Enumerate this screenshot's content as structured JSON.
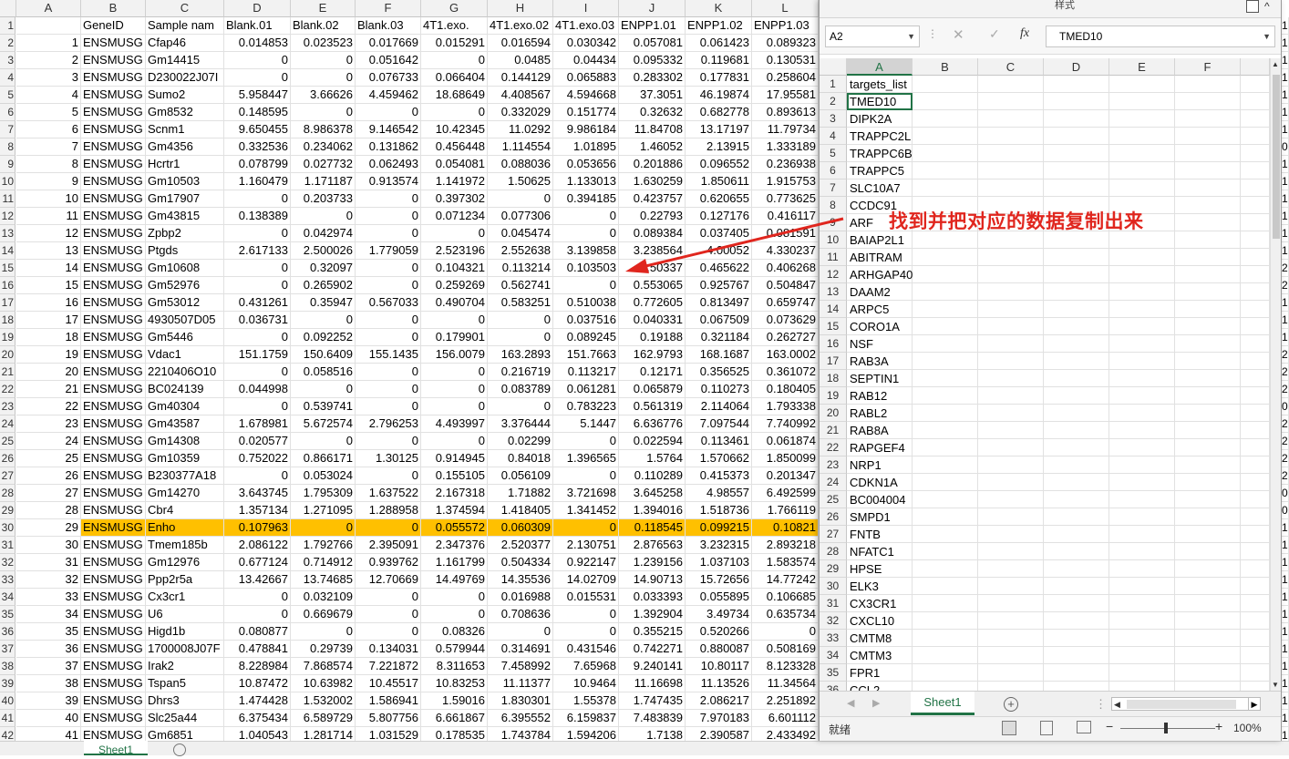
{
  "main_sheet": {
    "columns": [
      "A",
      "B",
      "C",
      "D",
      "E",
      "F",
      "G",
      "H",
      "I",
      "J",
      "K",
      "L"
    ],
    "header_row": [
      "",
      "GeneID",
      "Sample nam",
      "Blank.01",
      "Blank.02",
      "Blank.03",
      "4T1.exo.",
      "4T1.exo.02",
      "4T1.exo.03",
      "ENPP1.01",
      "ENPP1.02",
      "ENPP1.03"
    ],
    "rows": [
      [
        "1",
        "ENSMUSG",
        "Cfap46",
        "0.014853",
        "0.023523",
        "0.017669",
        "0.015291",
        "0.016594",
        "0.030342",
        "0.057081",
        "0.061423",
        "0.089323"
      ],
      [
        "2",
        "ENSMUSG",
        "Gm14415",
        "0",
        "0",
        "0.051642",
        "0",
        "0.0485",
        "0.04434",
        "0.095332",
        "0.119681",
        "0.130531"
      ],
      [
        "3",
        "ENSMUSG",
        "D230022J07I",
        "0",
        "0",
        "0.076733",
        "0.066404",
        "0.144129",
        "0.065883",
        "0.283302",
        "0.177831",
        "0.258604"
      ],
      [
        "4",
        "ENSMUSG",
        "Sumo2",
        "5.958447",
        "3.66626",
        "4.459462",
        "18.68649",
        "4.408567",
        "4.594668",
        "37.3051",
        "46.19874",
        "17.95581"
      ],
      [
        "5",
        "ENSMUSG",
        "Gm8532",
        "0.148595",
        "0",
        "0",
        "0",
        "0.332029",
        "0.151774",
        "0.32632",
        "0.682778",
        "0.893613"
      ],
      [
        "6",
        "ENSMUSG",
        "Scnm1",
        "9.650455",
        "8.986378",
        "9.146542",
        "10.42345",
        "11.0292",
        "9.986184",
        "11.84708",
        "13.17197",
        "11.79734"
      ],
      [
        "7",
        "ENSMUSG",
        "Gm4356",
        "0.332536",
        "0.234062",
        "0.131862",
        "0.456448",
        "1.114554",
        "1.01895",
        "1.46052",
        "2.13915",
        "1.333189"
      ],
      [
        "8",
        "ENSMUSG",
        "Hcrtr1",
        "0.078799",
        "0.027732",
        "0.062493",
        "0.054081",
        "0.088036",
        "0.053656",
        "0.201886",
        "0.096552",
        "0.236938"
      ],
      [
        "9",
        "ENSMUSG",
        "Gm10503",
        "1.160479",
        "1.171187",
        "0.913574",
        "1.141972",
        "1.50625",
        "1.133013",
        "1.630259",
        "1.850611",
        "1.915753"
      ],
      [
        "10",
        "ENSMUSG",
        "Gm17907",
        "0",
        "0.203733",
        "0",
        "0.397302",
        "0",
        "0.394185",
        "0.423757",
        "0.620655",
        "0.773625"
      ],
      [
        "11",
        "ENSMUSG",
        "Gm43815",
        "0.138389",
        "0",
        "0",
        "0.071234",
        "0.077306",
        "0",
        "0.22793",
        "0.127176",
        "0.416117"
      ],
      [
        "12",
        "ENSMUSG",
        "Zpbp2",
        "0",
        "0.042974",
        "0",
        "0",
        "0.045474",
        "0",
        "0.089384",
        "0.037405",
        "0.081591"
      ],
      [
        "13",
        "ENSMUSG",
        "Ptgds",
        "2.617133",
        "2.500026",
        "1.779059",
        "2.523196",
        "2.552638",
        "3.139858",
        "3.238564",
        "4.00052",
        "4.330237"
      ],
      [
        "14",
        "ENSMUSG",
        "Gm10608",
        "0",
        "0.32097",
        "0",
        "0.104321",
        "0.113214",
        "0.103503",
        "0.50337",
        "0.465622",
        "0.406268"
      ],
      [
        "15",
        "ENSMUSG",
        "Gm52976",
        "0",
        "0.265902",
        "0",
        "0.259269",
        "0.562741",
        "0",
        "0.553065",
        "0.925767",
        "0.504847"
      ],
      [
        "16",
        "ENSMUSG",
        "Gm53012",
        "0.431261",
        "0.35947",
        "0.567033",
        "0.490704",
        "0.583251",
        "0.510038",
        "0.772605",
        "0.813497",
        "0.659747"
      ],
      [
        "17",
        "ENSMUSG",
        "4930507D05",
        "0.036731",
        "0",
        "0",
        "0",
        "0",
        "0.037516",
        "0.040331",
        "0.067509",
        "0.073629"
      ],
      [
        "18",
        "ENSMUSG",
        "Gm5446",
        "0",
        "0.092252",
        "0",
        "0.179901",
        "0",
        "0.089245",
        "0.19188",
        "0.321184",
        "0.262727"
      ],
      [
        "19",
        "ENSMUSG",
        "Vdac1",
        "151.1759",
        "150.6409",
        "155.1435",
        "156.0079",
        "163.2893",
        "151.7663",
        "162.9793",
        "168.1687",
        "163.0002"
      ],
      [
        "20",
        "ENSMUSG",
        "2210406O10",
        "0",
        "0.058516",
        "0",
        "0",
        "0.216719",
        "0.113217",
        "0.12171",
        "0.356525",
        "0.361072"
      ],
      [
        "21",
        "ENSMUSG",
        "BC024139",
        "0.044998",
        "0",
        "0",
        "0",
        "0.083789",
        "0.061281",
        "0.065879",
        "0.110273",
        "0.180405"
      ],
      [
        "22",
        "ENSMUSG",
        "Gm40304",
        "0",
        "0.539741",
        "0",
        "0",
        "0",
        "0.783223",
        "0.561319",
        "2.114064",
        "1.793338"
      ],
      [
        "23",
        "ENSMUSG",
        "Gm43587",
        "1.678981",
        "5.672574",
        "2.796253",
        "4.493997",
        "3.376444",
        "5.1447",
        "6.636776",
        "7.097544",
        "7.740992"
      ],
      [
        "24",
        "ENSMUSG",
        "Gm14308",
        "0.020577",
        "0",
        "0",
        "0",
        "0.02299",
        "0",
        "0.022594",
        "0.113461",
        "0.061874"
      ],
      [
        "25",
        "ENSMUSG",
        "Gm10359",
        "0.752022",
        "0.866171",
        "1.30125",
        "0.914945",
        "0.84018",
        "1.396565",
        "1.5764",
        "1.570662",
        "1.850099"
      ],
      [
        "26",
        "ENSMUSG",
        "B230377A18",
        "0",
        "0.053024",
        "0",
        "0.155105",
        "0.056109",
        "0",
        "0.110289",
        "0.415373",
        "0.201347"
      ],
      [
        "27",
        "ENSMUSG",
        "Gm14270",
        "3.643745",
        "1.795309",
        "1.637522",
        "2.167318",
        "1.71882",
        "3.721698",
        "3.645258",
        "4.98557",
        "6.492599"
      ],
      [
        "28",
        "ENSMUSG",
        "Cbr4",
        "1.357134",
        "1.271095",
        "1.288958",
        "1.374594",
        "1.418405",
        "1.341452",
        "1.394016",
        "1.518736",
        "1.766119"
      ],
      [
        "29",
        "ENSMUSG",
        "Enho",
        "0.107963",
        "0",
        "0",
        "0.055572",
        "0.060309",
        "0",
        "0.118545",
        "0.099215",
        "0.10821"
      ],
      [
        "30",
        "ENSMUSG",
        "Tmem185b",
        "2.086122",
        "1.792766",
        "2.395091",
        "2.347376",
        "2.520377",
        "2.130751",
        "2.876563",
        "3.232315",
        "2.893218"
      ],
      [
        "31",
        "ENSMUSG",
        "Gm12976",
        "0.677124",
        "0.714912",
        "0.939762",
        "1.161799",
        "0.504334",
        "0.922147",
        "1.239156",
        "1.037103",
        "1.583574"
      ],
      [
        "32",
        "ENSMUSG",
        "Ppp2r5a",
        "13.42667",
        "13.74685",
        "12.70669",
        "14.49769",
        "14.35536",
        "14.02709",
        "14.90713",
        "15.72656",
        "14.77242"
      ],
      [
        "33",
        "ENSMUSG",
        "Cx3cr1",
        "0",
        "0.032109",
        "0",
        "0",
        "0.016988",
        "0.015531",
        "0.033393",
        "0.055895",
        "0.106685"
      ],
      [
        "34",
        "ENSMUSG",
        "U6",
        "0",
        "0.669679",
        "0",
        "0",
        "0.708636",
        "0",
        "1.392904",
        "3.49734",
        "0.635734"
      ],
      [
        "35",
        "ENSMUSG",
        "Higd1b",
        "0.080877",
        "0",
        "0",
        "0.08326",
        "0",
        "0",
        "0.355215",
        "0.520266",
        "0"
      ],
      [
        "36",
        "ENSMUSG",
        "1700008J07F",
        "0.478841",
        "0.29739",
        "0.134031",
        "0.579944",
        "0.314691",
        "0.431546",
        "0.742271",
        "0.880087",
        "0.508169"
      ],
      [
        "37",
        "ENSMUSG",
        "Irak2",
        "8.228984",
        "7.868574",
        "7.221872",
        "8.311653",
        "7.458992",
        "7.65968",
        "9.240141",
        "10.80117",
        "8.123328"
      ],
      [
        "38",
        "ENSMUSG",
        "Tspan5",
        "10.87472",
        "10.63982",
        "10.45517",
        "10.83253",
        "11.11377",
        "10.9464",
        "11.16698",
        "11.13526",
        "11.34564"
      ],
      [
        "39",
        "ENSMUSG",
        "Dhrs3",
        "1.474428",
        "1.532002",
        "1.586941",
        "1.59016",
        "1.830301",
        "1.55378",
        "1.747435",
        "2.086217",
        "2.251892"
      ],
      [
        "40",
        "ENSMUSG",
        "Slc25a44",
        "6.375434",
        "6.589729",
        "5.807756",
        "6.661867",
        "6.395552",
        "6.159837",
        "7.483839",
        "7.970183",
        "6.601112"
      ],
      [
        "41",
        "ENSMUSG",
        "Gm6851",
        "1.040543",
        "1.281714",
        "1.031529",
        "0.178535",
        "1.743784",
        "1.594206",
        "1.7138",
        "2.390587",
        "2.433492"
      ]
    ],
    "highlight_row_label": "30",
    "highlight_color": "#ffc000",
    "right_edge_digits": [
      "1",
      "1",
      "1",
      "1",
      "1",
      "1",
      "1",
      "0",
      "1",
      "1",
      "1",
      "1",
      "1",
      "1",
      "2",
      "2",
      "1",
      "1",
      "1",
      "2",
      "2",
      "2",
      "0",
      "2",
      "2",
      "2",
      "2",
      "0",
      "0",
      "1",
      "1",
      "1",
      "1",
      "1",
      "1",
      "1",
      "1",
      "1",
      "1",
      "1",
      "1",
      "1"
    ],
    "tab_label": "Sheet1"
  },
  "second_window": {
    "ribbon_label": "样式",
    "name_box": "A2",
    "formula_value": "TMED10",
    "columns": [
      "A",
      "B",
      "C",
      "D",
      "E",
      "F"
    ],
    "cells": [
      "targets_list",
      "TMED10",
      "DIPK2A",
      "TRAPPC2L",
      "TRAPPC6B",
      "TRAPPC5",
      "SLC10A7",
      "CCDC91",
      "ARF",
      "BAIAP2L1",
      "ABITRAM",
      "ARHGAP40",
      "DAAM2",
      "ARPC5",
      "CORO1A",
      "NSF",
      "RAB3A",
      "SEPTIN1",
      "RAB12",
      "RABL2",
      "RAB8A",
      "RAPGEF4",
      "NRP1",
      "CDKN1A",
      "BC004004",
      "SMPD1",
      "FNTB",
      "NFATC1",
      "HPSE",
      "ELK3",
      "CX3CR1",
      "CXCL10",
      "CMTM8",
      "CMTM3",
      "FPR1",
      "CCL2"
    ],
    "sheet_tab": "Sheet1",
    "status_text": "就绪",
    "zoom_level": "100%"
  },
  "annotation": {
    "text": "找到并把对应的数据复制出来",
    "color": "#e0261e"
  },
  "icons": {
    "function_icon": "fx"
  }
}
